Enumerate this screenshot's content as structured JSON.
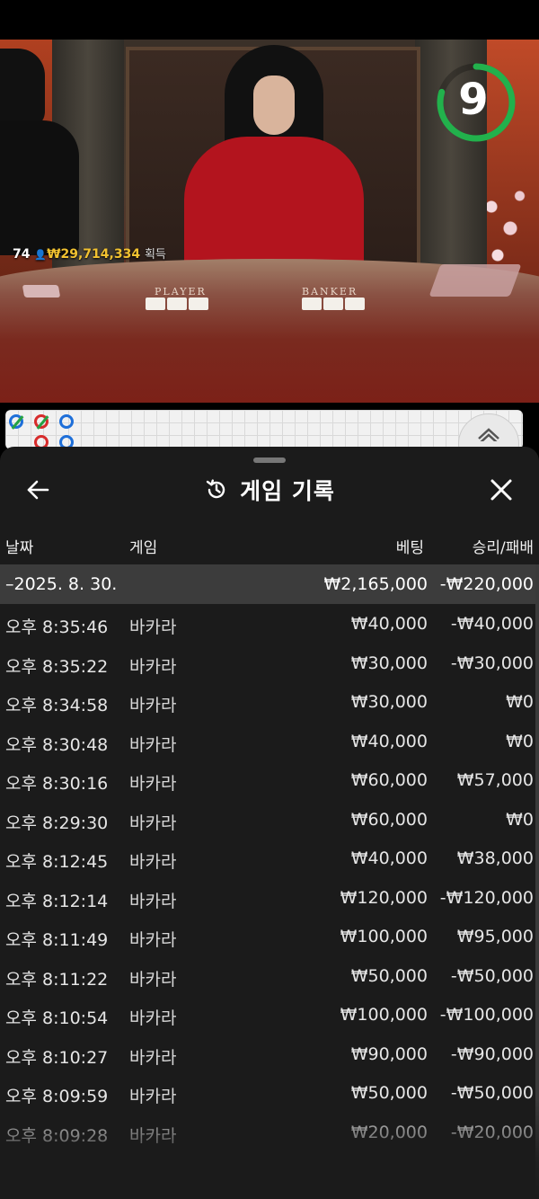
{
  "video": {
    "timer": "9",
    "winners_count": "74",
    "winners_amount": "₩29,714,334",
    "winners_suffix": "획득",
    "table_player": "PLAYER",
    "table_banker": "BANKER"
  },
  "colors": {
    "timer_ring": "#22b14c",
    "winners_amount": "#f2c230",
    "sheet_bg": "#1b1b1b",
    "summary_bg": "#3c3c3c",
    "player_bead": "#1e6fd9",
    "banker_bead": "#d72b2b"
  },
  "history": {
    "title": "게임 기록",
    "icons": {
      "back": "back-arrow-icon",
      "title": "history-clock-icon",
      "close": "close-icon"
    },
    "columns": {
      "date": "날짜",
      "game": "게임",
      "bet": "베팅",
      "result": "승리/패배"
    },
    "summary": {
      "date": "–2025. 8. 30.",
      "bet": "₩2,165,000",
      "result": "-₩220,000"
    },
    "rows": [
      {
        "time": "오후 8:35:46",
        "game": "바카라",
        "bet": "₩40,000",
        "result": "-₩40,000"
      },
      {
        "time": "오후 8:35:22",
        "game": "바카라",
        "bet": "₩30,000",
        "result": "-₩30,000"
      },
      {
        "time": "오후 8:34:58",
        "game": "바카라",
        "bet": "₩30,000",
        "result": "₩0"
      },
      {
        "time": "오후 8:30:48",
        "game": "바카라",
        "bet": "₩40,000",
        "result": "₩0"
      },
      {
        "time": "오후 8:30:16",
        "game": "바카라",
        "bet": "₩60,000",
        "result": "₩57,000"
      },
      {
        "time": "오후 8:29:30",
        "game": "바카라",
        "bet": "₩60,000",
        "result": "₩0"
      },
      {
        "time": "오후 8:12:45",
        "game": "바카라",
        "bet": "₩40,000",
        "result": "₩38,000"
      },
      {
        "time": "오후 8:12:14",
        "game": "바카라",
        "bet": "₩120,000",
        "result": "-₩120,000"
      },
      {
        "time": "오후 8:11:49",
        "game": "바카라",
        "bet": "₩100,000",
        "result": "₩95,000"
      },
      {
        "time": "오후 8:11:22",
        "game": "바카라",
        "bet": "₩50,000",
        "result": "-₩50,000"
      },
      {
        "time": "오후 8:10:54",
        "game": "바카라",
        "bet": "₩100,000",
        "result": "-₩100,000"
      },
      {
        "time": "오후 8:10:27",
        "game": "바카라",
        "bet": "₩90,000",
        "result": "-₩90,000"
      },
      {
        "time": "오후 8:09:59",
        "game": "바카라",
        "bet": "₩50,000",
        "result": "-₩50,000"
      },
      {
        "time": "오후 8:09:28",
        "game": "바카라",
        "bet": "₩20,000",
        "result": "-₩20,000"
      }
    ]
  }
}
